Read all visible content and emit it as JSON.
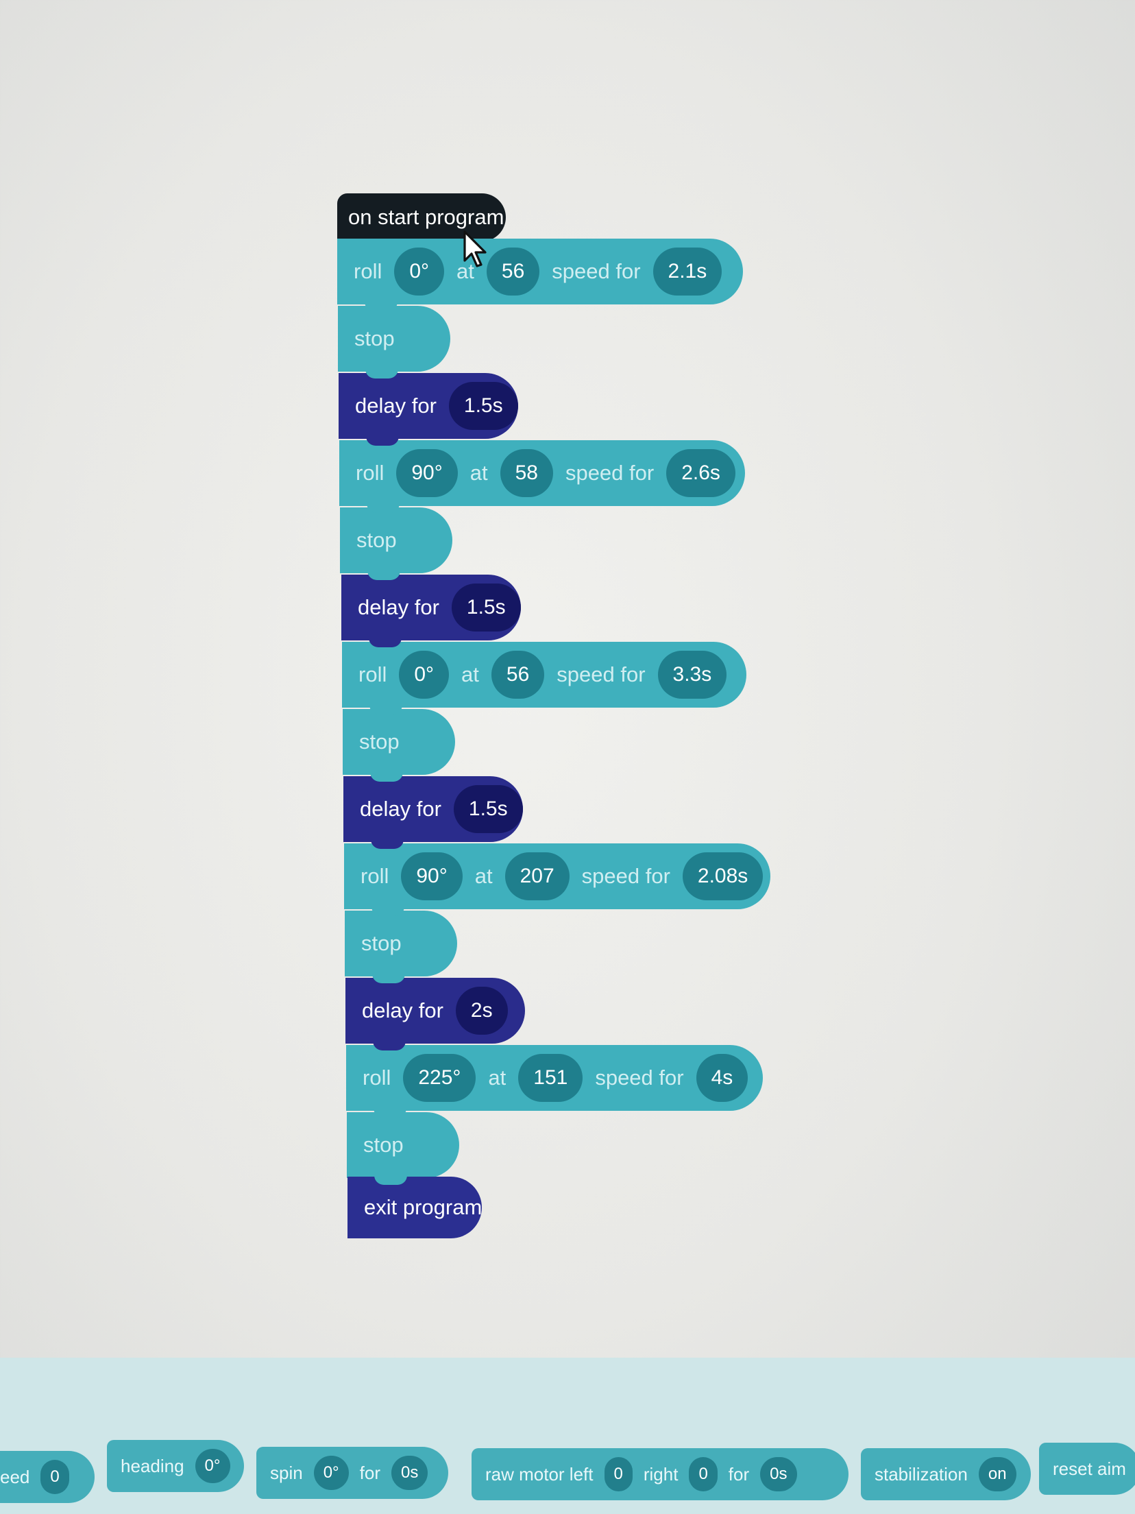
{
  "program": {
    "start_label": "on start program",
    "exit_label": "exit program",
    "blocks": [
      {
        "type": "roll",
        "heading": "0°",
        "speed": "56",
        "duration": "2.1s"
      },
      {
        "type": "stop"
      },
      {
        "type": "delay",
        "duration": "1.5s"
      },
      {
        "type": "roll",
        "heading": "90°",
        "speed": "58",
        "duration": "2.6s"
      },
      {
        "type": "stop"
      },
      {
        "type": "delay",
        "duration": "1.5s"
      },
      {
        "type": "roll",
        "heading": "0°",
        "speed": "56",
        "duration": "3.3s"
      },
      {
        "type": "stop"
      },
      {
        "type": "delay",
        "duration": "1.5s"
      },
      {
        "type": "roll",
        "heading": "90°",
        "speed": "207",
        "duration": "2.08s"
      },
      {
        "type": "stop"
      },
      {
        "type": "delay",
        "duration": "2s"
      },
      {
        "type": "roll",
        "heading": "225°",
        "speed": "151",
        "duration": "4s"
      },
      {
        "type": "stop"
      }
    ]
  },
  "labels": {
    "roll": "roll",
    "at": "at",
    "speed_for": "speed for",
    "stop": "stop",
    "delay_for": "delay for"
  },
  "toolbar": {
    "speed_partial": "eed",
    "speed_value": "0",
    "heading_label": "heading",
    "heading_value": "0°",
    "spin_label": "spin",
    "spin_value": "0°",
    "spin_for": "for",
    "spin_duration": "0s",
    "raw_motor_label": "raw motor left",
    "raw_left_value": "0",
    "raw_right_label": "right",
    "raw_right_value": "0",
    "raw_for": "for",
    "raw_duration": "0s",
    "stabilization_label": "stabilization",
    "stabilization_value": "on",
    "reset_aim_label": "reset aim"
  },
  "colors": {
    "motion_block": "#3fb0bd",
    "motion_pill": "#1f7f8d",
    "control_block": "#2a2c8c",
    "control_pill": "#151763",
    "hat_block": "#141c22"
  }
}
